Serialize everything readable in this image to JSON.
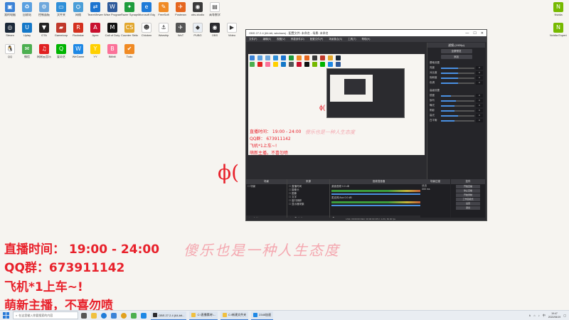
{
  "desktop_icons_row1": [
    {
      "label": "我的电脑",
      "color": "#3b82d6",
      "glyph": "▣"
    },
    {
      "label": "回收站",
      "color": "#5aa0e0",
      "glyph": "♻"
    },
    {
      "label": "控制面板",
      "color": "#6fa8dc",
      "glyph": "⚙"
    },
    {
      "label": "文件夹",
      "color": "#2f8fd8",
      "glyph": "▭"
    },
    {
      "label": "网络",
      "color": "#4a9ed8",
      "glyph": "⛭"
    },
    {
      "label": "TeamViewer",
      "color": "#1b74d0",
      "glyph": "⇄"
    },
    {
      "label": "Wise Program",
      "color": "#2e5a9a",
      "glyph": "W"
    },
    {
      "label": "Razer Synapse",
      "color": "#1e9c3c",
      "glyph": "✦"
    },
    {
      "label": "Microsoft Edge",
      "color": "#1f7bd8",
      "glyph": "e"
    },
    {
      "label": "FreeSoft",
      "color": "#f08a24",
      "glyph": "✎"
    },
    {
      "label": "Postman",
      "color": "#e5661f",
      "glyph": "✈"
    },
    {
      "label": "obs-studio",
      "color": "#3a3a3a",
      "glyph": "◉"
    },
    {
      "label": "高等数学",
      "color": "#ffffff",
      "glyph": "▤"
    }
  ],
  "desktop_icons_row2": [
    {
      "label": "Steam",
      "color": "#1b2838",
      "glyph": "◎"
    },
    {
      "label": "Uplay",
      "color": "#1478c8",
      "glyph": "U"
    },
    {
      "label": "GTA",
      "color": "#222222",
      "glyph": "▼"
    },
    {
      "label": "Gameloop",
      "color": "#c0392b",
      "glyph": "▰"
    },
    {
      "label": "Rockstar",
      "color": "#d4311f",
      "glyph": "R"
    },
    {
      "label": "Apex",
      "color": "#c8102e",
      "glyph": "A"
    },
    {
      "label": "Call of Duty",
      "color": "#111111",
      "glyph": "M"
    },
    {
      "label": "Counter Strike",
      "color": "#e2a72e",
      "glyph": "CS"
    },
    {
      "label": "Chicken",
      "color": "#ffffff",
      "glyph": "☻"
    },
    {
      "label": "Warship",
      "color": "#ffffff",
      "glyph": "⚓"
    },
    {
      "label": "WoT",
      "color": "#555555",
      "glyph": "✈"
    },
    {
      "label": "PUBG",
      "color": "#e9eef4",
      "glyph": "◆"
    },
    {
      "label": "OBS",
      "color": "#2b2b2f",
      "glyph": "◉"
    },
    {
      "label": "Video",
      "color": "#ffffff",
      "glyph": "▶"
    }
  ],
  "desktop_icons_row3": [
    {
      "label": "QQ",
      "color": "#ffffff",
      "glyph": "🐧"
    },
    {
      "label": "微信",
      "color": "#4caf50",
      "glyph": "✉"
    },
    {
      "label": "网易云音乐",
      "color": "#e02020",
      "glyph": "♫"
    },
    {
      "label": "爱奇艺",
      "color": "#00b400",
      "glyph": "Q"
    },
    {
      "label": "WeGame",
      "color": "#1e88e5",
      "glyph": "W"
    },
    {
      "label": "YY",
      "color": "#ffd000",
      "glyph": "Y"
    },
    {
      "label": "Bilibili",
      "color": "#fb7299",
      "glyph": "B"
    },
    {
      "label": "Todo",
      "color": "#f08a24",
      "glyph": "✔"
    }
  ],
  "right_icons": [
    {
      "label": "Nvidia",
      "color": "#76b900",
      "glyph": "N"
    },
    {
      "label": "Nvidia Experience",
      "color": "#76b900",
      "glyph": "N"
    }
  ],
  "overlay": {
    "line1": "直播时间： 19:00 - 24:00",
    "line2": "QQ群：673911142",
    "line3": "飞机*1上车~!",
    "line4": "萌新主播，不喜勿喷",
    "motto": "傻乐也是一种人生态度",
    "phi": "ϕ("
  },
  "obs": {
    "title": "OBS 27.2.4 (64-bit, windows) - 配置文件: 未命名 - 场景: 未命名",
    "menu": [
      "文件(F)",
      "编辑(E)",
      "视图(V)",
      "停靠部件(D)",
      "配置文件(P)",
      "场景集合(S)",
      "工具(T)",
      "帮助(H)"
    ],
    "preview_lines": [
      "直播时间： 19:00 - 24:00",
      "QQ群： 673911142",
      "飞机*1上车~!",
      "萌新主播，不喜勿喷"
    ],
    "preview_motto": "傻乐也是一种人生态度",
    "preview_phi": "ϕ(",
    "right_panel": {
      "header": "滤镜 (1920p)",
      "buttons": [
        "全屏预览",
        "添加"
      ],
      "section1": "基础设置",
      "sliders": [
        {
          "label": "亮度",
          "value": "0",
          "fill": 0.5
        },
        {
          "label": "对比度",
          "value": "0",
          "fill": 0.5
        },
        {
          "label": "饱和度",
          "value": "0",
          "fill": 0.5
        },
        {
          "label": "色调",
          "value": "0",
          "fill": 0.5
        }
      ],
      "section2": "高级设置",
      "sliders2": [
        {
          "label": "锐度",
          "value": "0",
          "fill": 0.3
        },
        {
          "label": "伽马",
          "value": "0",
          "fill": 0.45
        },
        {
          "label": "曝光",
          "value": "0",
          "fill": 0.4
        },
        {
          "label": "阴影",
          "value": "0",
          "fill": 0.4
        },
        {
          "label": "高光",
          "value": "0",
          "fill": 0.5
        },
        {
          "label": "白平衡",
          "value": "0",
          "fill": 0.4
        }
      ]
    },
    "scenes_title": "场景",
    "scenes": [
      "场景"
    ],
    "sources_title": "来源",
    "sources": [
      "直播时间",
      "摄像头",
      "图像",
      "文字",
      "窗口捕获",
      "显示器采集"
    ],
    "mixer_title": "音频混音器",
    "mixer": [
      {
        "name": "桌面音频",
        "db": "0.0 dB"
      },
      {
        "name": "麦克风/Aux",
        "db": "0.0 dB"
      }
    ],
    "transitions_title": "场景过渡",
    "transition": "淡出",
    "duration": "300 ms",
    "controls_title": "控件",
    "controls": [
      "开始直播",
      "停止直播",
      "开始录制",
      "工作室模式",
      "设置",
      "退出"
    ],
    "status": "LIVE: 00:00:00  REC: 00:00:00  CPU: 4.2%, 60.00 fps"
  },
  "taskbar": {
    "search_placeholder": "在这里输入你要搜索的内容",
    "apps": [
      {
        "label": "OBS 27.2.4 (64-bit...",
        "color": "#2b2b2f"
      },
      {
        "label": "C:\\直播素材\\...",
        "color": "#f0c040"
      },
      {
        "label": "C:\\新建文件夹",
        "color": "#f0c040"
      },
      {
        "label": "2345加速",
        "color": "#1e88e5"
      }
    ],
    "time": "19:47",
    "date": "2022/06/19"
  }
}
